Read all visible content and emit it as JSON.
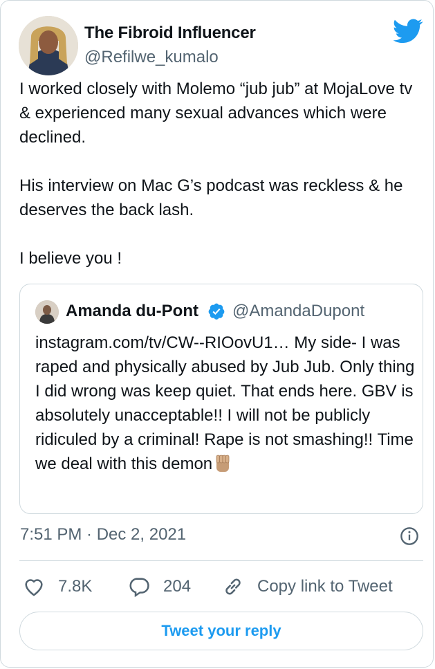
{
  "tweet": {
    "author_name": "The Fibroid Influencer",
    "author_handle": "@Refilwe_kumalo",
    "text": "I worked closely with Molemo “jub jub” at MojaLove tv & experienced many sexual advances which were declined.\n\nHis interview on Mac G’s podcast was reckless & he deserves the back lash.\n\nI believe you !",
    "timestamp": "7:51 PM · Dec 2, 2021"
  },
  "quoted_tweet": {
    "author_name": "Amanda du-Pont",
    "author_handle": "@AmandaDupont",
    "verified": true,
    "text": "instagram.com/tv/CW--RIOovU1… My side- I was raped and physically abused by Jub Jub. Only thing I did wrong was keep quiet. That ends here. GBV is absolutely unacceptable!! I will not be publicly ridiculed by a criminal! Rape is not smashing!! Time we deal with this demon"
  },
  "actions": {
    "likes": "7.8K",
    "replies": "204",
    "copy_link_label": "Copy link to Tweet"
  },
  "reply_button_label": "Tweet your reply",
  "icons": {
    "brand": "twitter-bird-icon",
    "like": "heart-icon",
    "reply": "speech-bubble-icon",
    "copy": "link-icon",
    "info": "info-icon",
    "verified": "verified-badge-icon",
    "emoji": "raised-fist-emoji-icon"
  },
  "colors": {
    "accent": "#1d9bf0",
    "secondary_text": "#536471",
    "border": "#cfd9de"
  }
}
